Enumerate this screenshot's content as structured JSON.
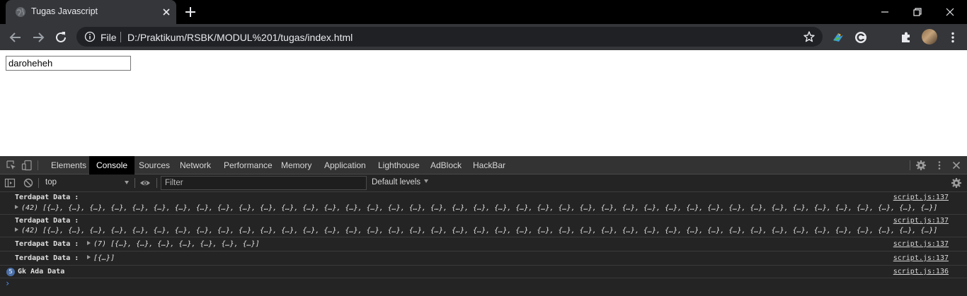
{
  "browser": {
    "tab": {
      "title": "Tugas Javascript",
      "favicon_icon": "globe-icon",
      "close_icon": "close-icon"
    },
    "new_tab_icon": "plus-icon",
    "window_controls": [
      "minimize-icon",
      "restore-icon",
      "close-icon"
    ],
    "toolbar": {
      "back_icon": "arrow-left-icon",
      "forward_icon": "arrow-right-icon",
      "reload_icon": "reload-icon",
      "scheme_label": "File",
      "url": "D:/Praktikum/RSBK/MODUL%201/tugas/index.html",
      "bookmark_icon": "star-icon",
      "extension_icons": [
        "idm-icon",
        "c-circle-icon",
        "puzzle-icon"
      ],
      "menu_icon": "kebab-icon"
    }
  },
  "page": {
    "input_value": "daroheheh"
  },
  "devtools": {
    "tabs": [
      "Elements",
      "Console",
      "Sources",
      "Network",
      "Performance",
      "Memory",
      "Application",
      "Lighthouse",
      "AdBlock",
      "HackBar"
    ],
    "active_tab": "Console",
    "context": "top",
    "filter_placeholder": "Filter",
    "levels_label": "Default levels",
    "messages": [
      {
        "label": "Terdapat Data :",
        "preview": "(42) [{…}, {…}, {…}, {…}, {…}, {…}, {…}, {…}, {…}, {…}, {…}, {…}, {…}, {…}, {…}, {…}, {…}, {…}, {…}, {…}, {…}, {…}, {…}, {…}, {…}, {…}, {…}, {…}, {…}, {…}, {…}, {…}, {…}, {…}, {…}, {…}, {…}, {…}, {…}, {…}, {…}, {…}]",
        "source": "script.js:137"
      },
      {
        "label": "Terdapat Data :",
        "preview": "(42) [{…}, {…}, {…}, {…}, {…}, {…}, {…}, {…}, {…}, {…}, {…}, {…}, {…}, {…}, {…}, {…}, {…}, {…}, {…}, {…}, {…}, {…}, {…}, {…}, {…}, {…}, {…}, {…}, {…}, {…}, {…}, {…}, {…}, {…}, {…}, {…}, {…}, {…}, {…}, {…}, {…}, {…}]",
        "source": "script.js:137"
      },
      {
        "label": "Terdapat Data :",
        "preview": "(7) [{…}, {…}, {…}, {…}, {…}, {…}, {…}]",
        "source": "script.js:137"
      },
      {
        "label": "Terdapat Data :",
        "preview": "[{…}]",
        "source": "script.js:137"
      },
      {
        "label": "Gk Ada Data",
        "repeat_count": "5",
        "source": "script.js:136"
      }
    ]
  }
}
